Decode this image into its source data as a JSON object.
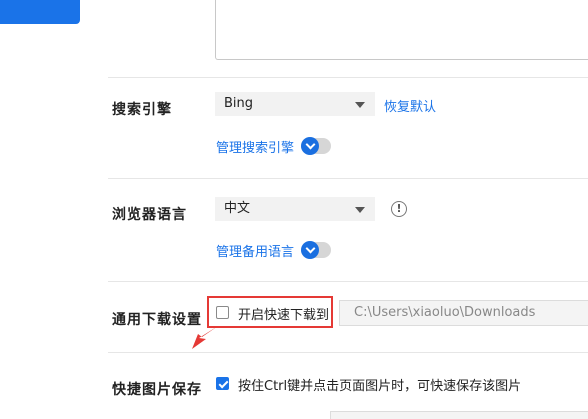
{
  "search_engine": {
    "label": "搜索引擎",
    "selected": "Bing",
    "restore_default_link": "恢复默认",
    "manage_link": "管理搜索引擎"
  },
  "browser_language": {
    "label": "浏览器语言",
    "selected": "中文",
    "info_icon_glyph": "!",
    "manage_link": "管理备用语言"
  },
  "download": {
    "label": "通用下载设置",
    "fast_download_checkbox_label": "开启快速下载到",
    "fast_download_checked": false,
    "path_value": "C:\\Users\\xiaoluo\\Downloads"
  },
  "quick_image_save": {
    "label": "快捷图片保存",
    "ctrl_click_checkbox_label": "按住Ctrl键并点击页面图片时，可快速保存该图片",
    "ctrl_click_checked": true
  },
  "colors": {
    "accent": "#1a73e8",
    "highlight": "#e53935"
  }
}
